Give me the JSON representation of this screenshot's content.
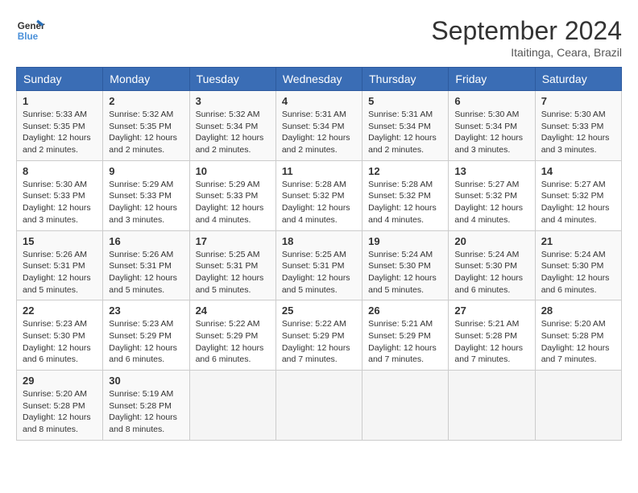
{
  "header": {
    "logo_line1": "General",
    "logo_line2": "Blue",
    "month": "September 2024",
    "location": "Itaitinga, Ceara, Brazil"
  },
  "days_of_week": [
    "Sunday",
    "Monday",
    "Tuesday",
    "Wednesday",
    "Thursday",
    "Friday",
    "Saturday"
  ],
  "weeks": [
    [
      {
        "day": 1,
        "lines": [
          "Sunrise: 5:33 AM",
          "Sunset: 5:35 PM",
          "Daylight: 12 hours",
          "and 2 minutes."
        ]
      },
      {
        "day": 2,
        "lines": [
          "Sunrise: 5:32 AM",
          "Sunset: 5:35 PM",
          "Daylight: 12 hours",
          "and 2 minutes."
        ]
      },
      {
        "day": 3,
        "lines": [
          "Sunrise: 5:32 AM",
          "Sunset: 5:34 PM",
          "Daylight: 12 hours",
          "and 2 minutes."
        ]
      },
      {
        "day": 4,
        "lines": [
          "Sunrise: 5:31 AM",
          "Sunset: 5:34 PM",
          "Daylight: 12 hours",
          "and 2 minutes."
        ]
      },
      {
        "day": 5,
        "lines": [
          "Sunrise: 5:31 AM",
          "Sunset: 5:34 PM",
          "Daylight: 12 hours",
          "and 2 minutes."
        ]
      },
      {
        "day": 6,
        "lines": [
          "Sunrise: 5:30 AM",
          "Sunset: 5:34 PM",
          "Daylight: 12 hours",
          "and 3 minutes."
        ]
      },
      {
        "day": 7,
        "lines": [
          "Sunrise: 5:30 AM",
          "Sunset: 5:33 PM",
          "Daylight: 12 hours",
          "and 3 minutes."
        ]
      }
    ],
    [
      {
        "day": 8,
        "lines": [
          "Sunrise: 5:30 AM",
          "Sunset: 5:33 PM",
          "Daylight: 12 hours",
          "and 3 minutes."
        ]
      },
      {
        "day": 9,
        "lines": [
          "Sunrise: 5:29 AM",
          "Sunset: 5:33 PM",
          "Daylight: 12 hours",
          "and 3 minutes."
        ]
      },
      {
        "day": 10,
        "lines": [
          "Sunrise: 5:29 AM",
          "Sunset: 5:33 PM",
          "Daylight: 12 hours",
          "and 4 minutes."
        ]
      },
      {
        "day": 11,
        "lines": [
          "Sunrise: 5:28 AM",
          "Sunset: 5:32 PM",
          "Daylight: 12 hours",
          "and 4 minutes."
        ]
      },
      {
        "day": 12,
        "lines": [
          "Sunrise: 5:28 AM",
          "Sunset: 5:32 PM",
          "Daylight: 12 hours",
          "and 4 minutes."
        ]
      },
      {
        "day": 13,
        "lines": [
          "Sunrise: 5:27 AM",
          "Sunset: 5:32 PM",
          "Daylight: 12 hours",
          "and 4 minutes."
        ]
      },
      {
        "day": 14,
        "lines": [
          "Sunrise: 5:27 AM",
          "Sunset: 5:32 PM",
          "Daylight: 12 hours",
          "and 4 minutes."
        ]
      }
    ],
    [
      {
        "day": 15,
        "lines": [
          "Sunrise: 5:26 AM",
          "Sunset: 5:31 PM",
          "Daylight: 12 hours",
          "and 5 minutes."
        ]
      },
      {
        "day": 16,
        "lines": [
          "Sunrise: 5:26 AM",
          "Sunset: 5:31 PM",
          "Daylight: 12 hours",
          "and 5 minutes."
        ]
      },
      {
        "day": 17,
        "lines": [
          "Sunrise: 5:25 AM",
          "Sunset: 5:31 PM",
          "Daylight: 12 hours",
          "and 5 minutes."
        ]
      },
      {
        "day": 18,
        "lines": [
          "Sunrise: 5:25 AM",
          "Sunset: 5:31 PM",
          "Daylight: 12 hours",
          "and 5 minutes."
        ]
      },
      {
        "day": 19,
        "lines": [
          "Sunrise: 5:24 AM",
          "Sunset: 5:30 PM",
          "Daylight: 12 hours",
          "and 5 minutes."
        ]
      },
      {
        "day": 20,
        "lines": [
          "Sunrise: 5:24 AM",
          "Sunset: 5:30 PM",
          "Daylight: 12 hours",
          "and 6 minutes."
        ]
      },
      {
        "day": 21,
        "lines": [
          "Sunrise: 5:24 AM",
          "Sunset: 5:30 PM",
          "Daylight: 12 hours",
          "and 6 minutes."
        ]
      }
    ],
    [
      {
        "day": 22,
        "lines": [
          "Sunrise: 5:23 AM",
          "Sunset: 5:30 PM",
          "Daylight: 12 hours",
          "and 6 minutes."
        ]
      },
      {
        "day": 23,
        "lines": [
          "Sunrise: 5:23 AM",
          "Sunset: 5:29 PM",
          "Daylight: 12 hours",
          "and 6 minutes."
        ]
      },
      {
        "day": 24,
        "lines": [
          "Sunrise: 5:22 AM",
          "Sunset: 5:29 PM",
          "Daylight: 12 hours",
          "and 6 minutes."
        ]
      },
      {
        "day": 25,
        "lines": [
          "Sunrise: 5:22 AM",
          "Sunset: 5:29 PM",
          "Daylight: 12 hours",
          "and 7 minutes."
        ]
      },
      {
        "day": 26,
        "lines": [
          "Sunrise: 5:21 AM",
          "Sunset: 5:29 PM",
          "Daylight: 12 hours",
          "and 7 minutes."
        ]
      },
      {
        "day": 27,
        "lines": [
          "Sunrise: 5:21 AM",
          "Sunset: 5:28 PM",
          "Daylight: 12 hours",
          "and 7 minutes."
        ]
      },
      {
        "day": 28,
        "lines": [
          "Sunrise: 5:20 AM",
          "Sunset: 5:28 PM",
          "Daylight: 12 hours",
          "and 7 minutes."
        ]
      }
    ],
    [
      {
        "day": 29,
        "lines": [
          "Sunrise: 5:20 AM",
          "Sunset: 5:28 PM",
          "Daylight: 12 hours",
          "and 8 minutes."
        ]
      },
      {
        "day": 30,
        "lines": [
          "Sunrise: 5:19 AM",
          "Sunset: 5:28 PM",
          "Daylight: 12 hours",
          "and 8 minutes."
        ]
      },
      null,
      null,
      null,
      null,
      null
    ]
  ]
}
